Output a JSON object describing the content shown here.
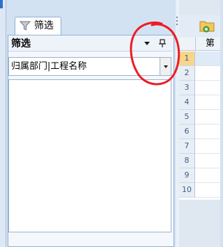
{
  "panel": {
    "tab_label": "筛选",
    "title": "筛选",
    "select_value": "归属部门|工程名称"
  },
  "grid": {
    "column_header": "第一",
    "rows": [
      "1",
      "2",
      "3",
      "4",
      "5",
      "6",
      "7",
      "8",
      "9",
      "10"
    ]
  },
  "colors": {
    "annotation_circle": "#ee1b24",
    "selected_row_header": "#f7d68a",
    "panel_border": "#8eaed2"
  }
}
